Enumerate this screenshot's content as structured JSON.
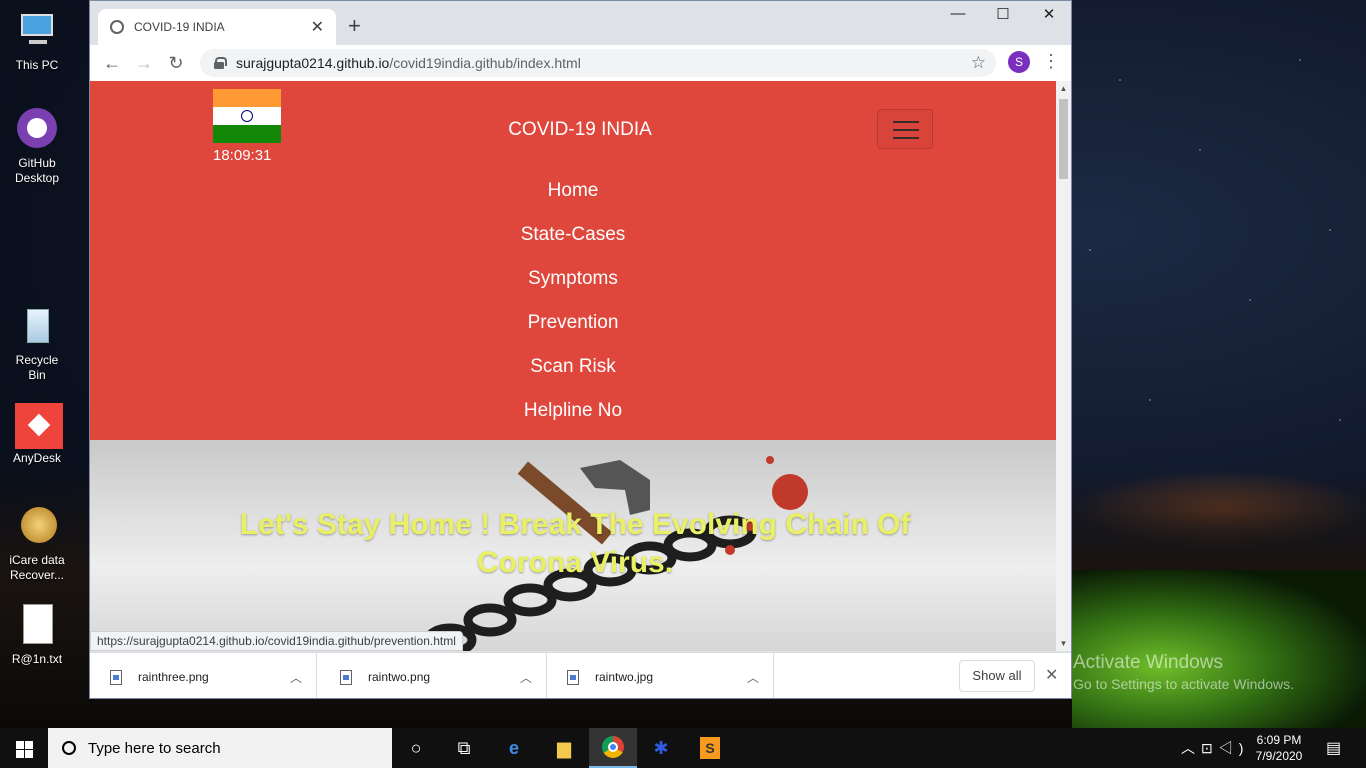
{
  "desktop": {
    "icons": [
      {
        "label": "This PC"
      },
      {
        "label": "GitHub Desktop"
      },
      {
        "label": "Recycle Bin"
      },
      {
        "label": "AnyDesk"
      },
      {
        "label": "iCare data Recover..."
      },
      {
        "label": "R@1n.txt"
      }
    ],
    "activate_title": "Activate Windows",
    "activate_sub": "Go to Settings to activate Windows."
  },
  "browser": {
    "tab_title": "COVID-19 INDIA",
    "url_host": "surajgupta0214.github.io",
    "url_path": "/covid19india.github/index.html",
    "profile_initial": "S",
    "status_url": "https://surajgupta0214.github.io/covid19india.github/prevention.html"
  },
  "page": {
    "clock": "18:09:31",
    "brand": "COVID-19 INDIA",
    "nav": [
      "Home",
      "State-Cases",
      "Symptoms",
      "Prevention",
      "Scan Risk",
      "Helpline No"
    ],
    "hero_text": "Let's Stay Home ! Break The Evolving Chain Of Corona Virus.",
    "colors": {
      "navbar": "#df473c",
      "hero_text": "#e9f063"
    }
  },
  "downloads": {
    "items": [
      "rainthree.png",
      "raintwo.png",
      "raintwo.jpg"
    ],
    "show_all": "Show all"
  },
  "taskbar": {
    "search_placeholder": "Type here to search",
    "time": "6:09 PM",
    "date": "7/9/2020"
  }
}
